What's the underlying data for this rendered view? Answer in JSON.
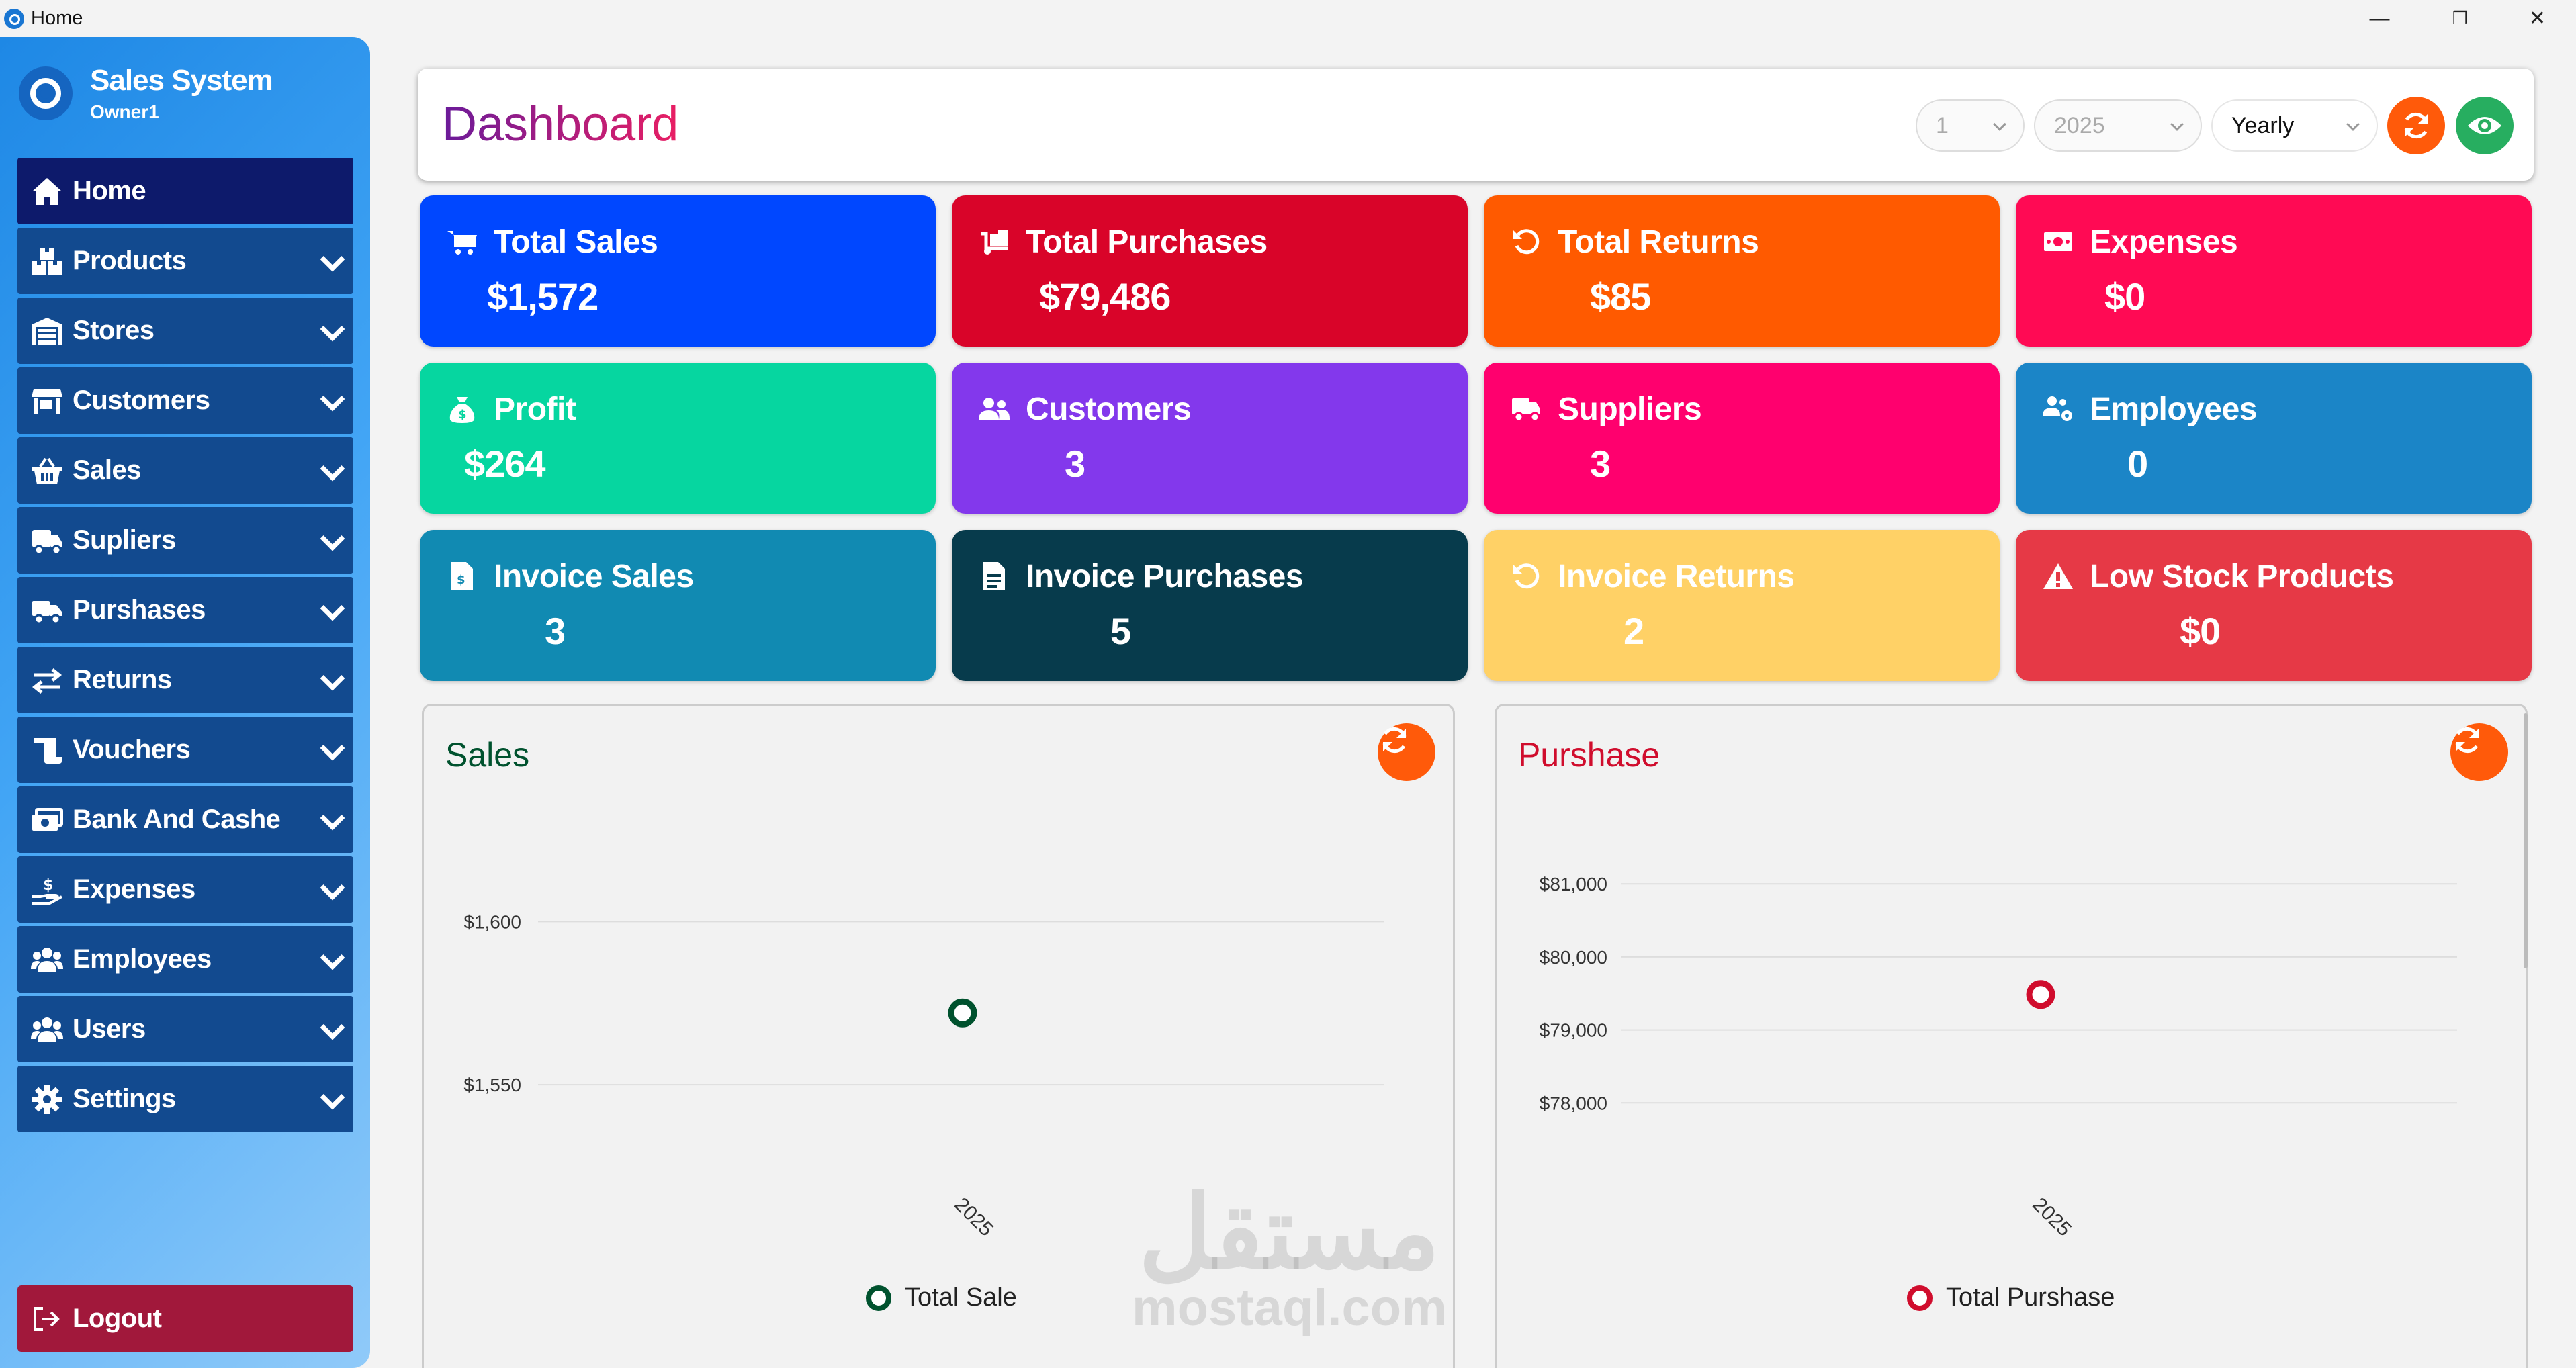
{
  "window": {
    "title": "Home",
    "min": "—",
    "restore": "❐",
    "close": "✕"
  },
  "sidebar": {
    "brand": "Sales System",
    "user": "Owner1",
    "items": [
      {
        "label": "Home",
        "icon": "home-icon"
      },
      {
        "label": "Products",
        "icon": "boxes-icon"
      },
      {
        "label": "Stores",
        "icon": "warehouse-icon"
      },
      {
        "label": "Customers",
        "icon": "store-icon"
      },
      {
        "label": "Sales",
        "icon": "basket-icon"
      },
      {
        "label": "Supliers",
        "icon": "truck-icon"
      },
      {
        "label": "Purshases",
        "icon": "cart-truck-icon"
      },
      {
        "label": "Returns",
        "icon": "arrows-icon"
      },
      {
        "label": "Vouchers",
        "icon": "scroll-icon"
      },
      {
        "label": "Bank And Cashe",
        "icon": "money-icon"
      },
      {
        "label": "Expenses",
        "icon": "hand-dollar-icon"
      },
      {
        "label": "Employees",
        "icon": "users-icon"
      },
      {
        "label": "Users",
        "icon": "users-icon"
      },
      {
        "label": "Settings",
        "icon": "gear-icon"
      }
    ],
    "logout": "Logout"
  },
  "header": {
    "title": "Dashboard",
    "month": "1",
    "year": "2025",
    "period": "Yearly"
  },
  "cards": [
    {
      "label": "Total Sales",
      "value": "$1,572",
      "color": "#0047ff",
      "icon": "cart-icon"
    },
    {
      "label": "Total Purchases",
      "value": "$79,486",
      "color": "#d90429",
      "icon": "dolly-icon"
    },
    {
      "label": "Total Returns",
      "value": "$85",
      "color": "#ff5a00",
      "icon": "undo-icon"
    },
    {
      "label": "Expenses",
      "value": "$0",
      "color": "#ff0a54",
      "icon": "money-icon"
    },
    {
      "label": "Profit",
      "value": "$264",
      "color": "#06d6a0",
      "icon": "money-bag-icon"
    },
    {
      "label": "Customers",
      "value": "3",
      "color": "#8338ec",
      "icon": "users-icon"
    },
    {
      "label": "Suppliers",
      "value": "3",
      "color": "#ff006e",
      "icon": "truck-icon"
    },
    {
      "label": "Employees",
      "value": "0",
      "color": "#1b85c7",
      "icon": "users-gear-icon"
    },
    {
      "label": "Invoice Sales",
      "value": "3",
      "color": "#118ab2",
      "icon": "invoice-dollar-icon"
    },
    {
      "label": "Invoice Purchases",
      "value": "5",
      "color": "#073b4c",
      "icon": "invoice-icon"
    },
    {
      "label": "Invoice Returns",
      "value": "2",
      "color": "#ffd166",
      "icon": "undo-icon"
    },
    {
      "label": "Low Stock Products",
      "value": "$0",
      "color": "#e63946",
      "icon": "warning-icon"
    }
  ],
  "charts": {
    "sales_title": "Sales",
    "purchase_title": "Purshase",
    "sales_color": "#00522e",
    "purchase_color": "#d00d2d"
  },
  "chart_data": [
    {
      "type": "line",
      "title": "Sales",
      "x": [
        "2025"
      ],
      "series": [
        {
          "name": "Total Sale",
          "values": [
            1572
          ]
        }
      ],
      "yticks": [
        "$1,550",
        "$1,600"
      ],
      "ylim": [
        1522,
        1625
      ],
      "grid": true,
      "legend": "bottom"
    },
    {
      "type": "line",
      "title": "Purshase",
      "x": [
        "2025"
      ],
      "series": [
        {
          "name": "Total Purshase",
          "values": [
            79486
          ]
        }
      ],
      "yticks": [
        "$78,000",
        "$79,000",
        "$80,000",
        "$81,000"
      ],
      "ylim": [
        77000,
        81600
      ],
      "grid": true,
      "legend": "bottom"
    }
  ],
  "watermark": {
    "arabic": "مستقل",
    "latin": "mostaql.com"
  }
}
